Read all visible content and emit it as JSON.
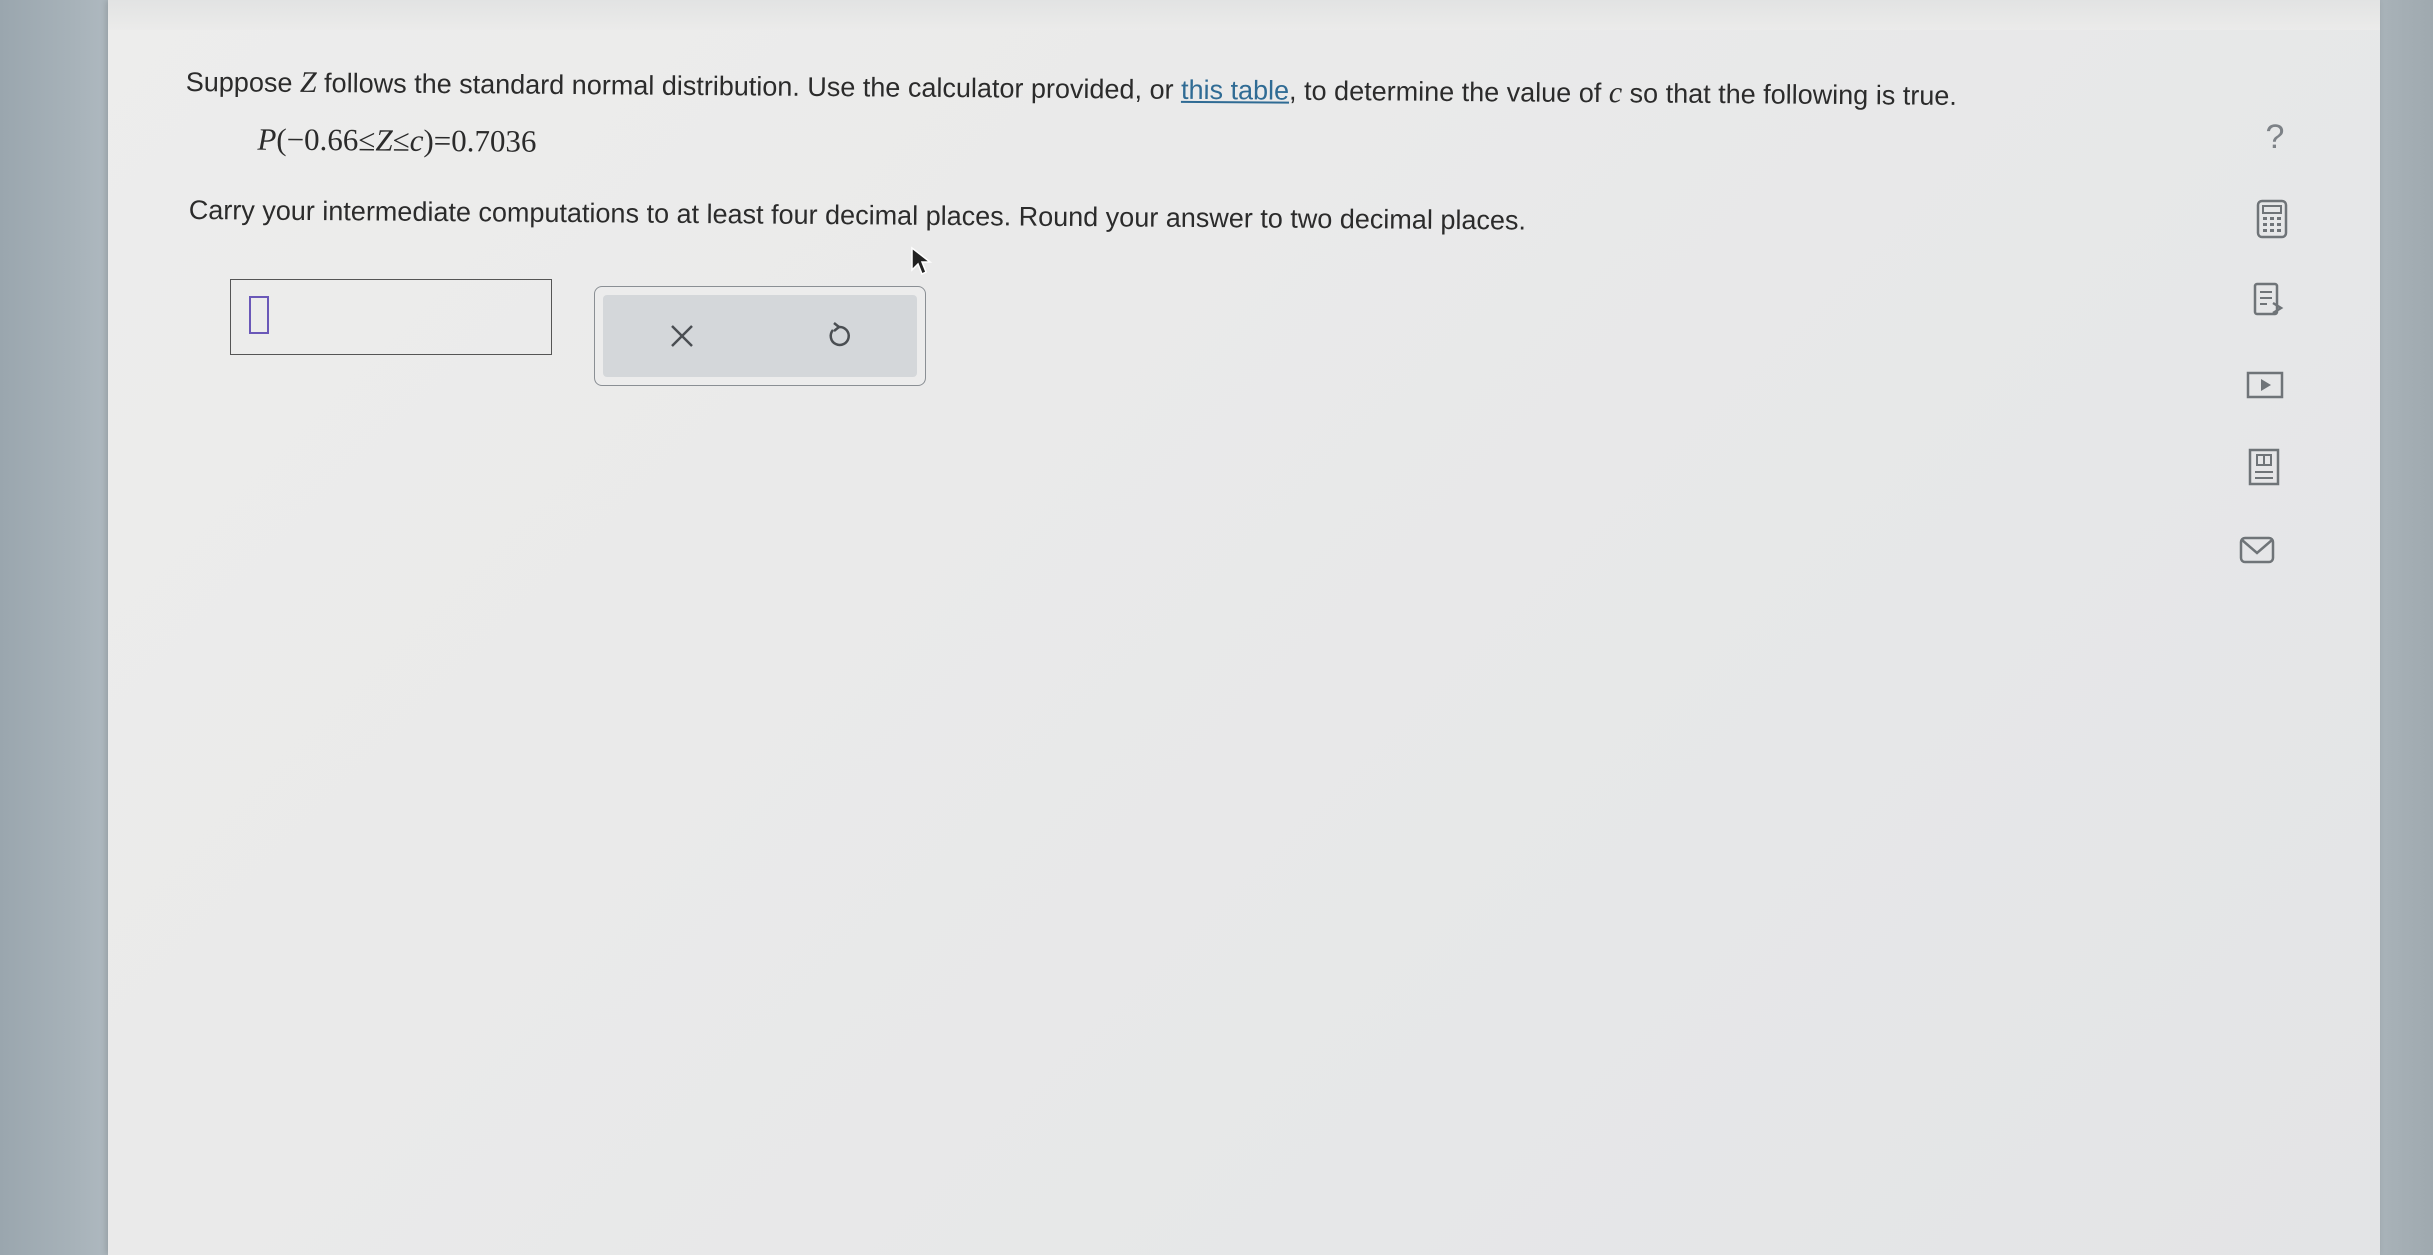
{
  "question": {
    "intro_before_z": "Suppose ",
    "z_symbol": "Z",
    "intro_after_z": " follows the standard normal distribution. Use the calculator provided, or ",
    "table_link": "this table",
    "intro_after_link": ", to determine the value of ",
    "c_symbol": "c",
    "intro_end": " so that the following is true.",
    "equation": {
      "p": "P",
      "open": "(−0.66≤",
      "z": "Z",
      "le": "≤",
      "c": "c",
      "close": ")=0.7036"
    },
    "instructions": "Carry your intermediate computations to at least four decimal places. Round your answer to two decimal places."
  },
  "answer": {
    "value": ""
  },
  "actions": {
    "clear_icon": "x-icon",
    "undo_icon": "undo-icon"
  },
  "side_tools": [
    {
      "icon": "help-icon",
      "label": "?"
    },
    {
      "icon": "calculator-icon"
    },
    {
      "icon": "reference-icon"
    },
    {
      "icon": "video-icon"
    },
    {
      "icon": "textbook-icon"
    },
    {
      "icon": "mail-icon"
    }
  ],
  "colors": {
    "link": "#2f6b94",
    "cursor_box": "#6a58b8",
    "text": "#2b2b2b"
  }
}
